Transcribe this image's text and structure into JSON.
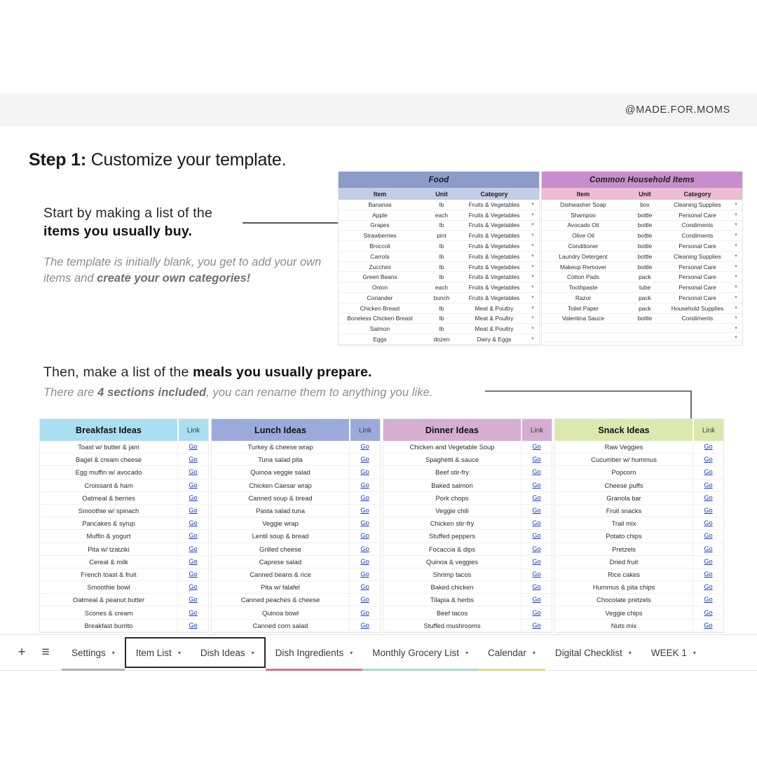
{
  "banner": {
    "handle": "@MADE.FOR.MOMS"
  },
  "heading": {
    "bold": "Step 1:",
    "normal": "Customize your template."
  },
  "callout1": {
    "line1": "Start by making a list of the",
    "line2": "items you usually buy.",
    "sub_pre": "The template is initially blank, you get to add your own items and ",
    "sub_bold": "create your own categories!"
  },
  "callout2": {
    "l1_pre": "Then, make a list of the ",
    "l1_bold": "meals you usually prepare.",
    "l2_pre": "There are ",
    "l2_bold": "4 sections included",
    "l2_post": ", you can rename them to anything you like."
  },
  "sheets": [
    {
      "title": "Food",
      "title_color": "#8b9cc9",
      "subhead_color": "#c2cde6",
      "columns": [
        "Item",
        "Unit",
        "Category"
      ],
      "rows": [
        [
          "Bananas",
          "lb",
          "Fruits & Vegetables"
        ],
        [
          "Apple",
          "each",
          "Fruits & Vegetables"
        ],
        [
          "Grapes",
          "lb",
          "Fruits & Vegetables"
        ],
        [
          "Strawberries",
          "pint",
          "Fruits & Vegetables"
        ],
        [
          "Broccoli",
          "lb",
          "Fruits & Vegetables"
        ],
        [
          "Carrots",
          "lb",
          "Fruits & Vegetables"
        ],
        [
          "Zucchini",
          "lb",
          "Fruits & Vegetables"
        ],
        [
          "Green Beans",
          "lb",
          "Fruits & Vegetables"
        ],
        [
          "Onion",
          "each",
          "Fruits & Vegetables"
        ],
        [
          "Coriander",
          "bunch",
          "Fruits & Vegetables"
        ],
        [
          "Chicken Breast",
          "lb",
          "Meat & Poultry"
        ],
        [
          "Boneless Chicken Breast",
          "lb",
          "Meat & Poultry"
        ],
        [
          "Salmon",
          "lb",
          "Meat & Poultry"
        ],
        [
          "Eggs",
          "dozen",
          "Dairy & Eggs"
        ]
      ],
      "blank_rows": 0
    },
    {
      "title": "Common Household Items",
      "title_color": "#c78ecd",
      "subhead_color": "#edbcd5",
      "columns": [
        "Item",
        "Unit",
        "Category"
      ],
      "rows": [
        [
          "Dishwasher Soap",
          "box",
          "Cleaning Supplies"
        ],
        [
          "Shampoo",
          "bottle",
          "Personal Care"
        ],
        [
          "Avocado Oil",
          "bottle",
          "Condiments"
        ],
        [
          "Olive Oil",
          "bottle",
          "Condiments"
        ],
        [
          "Conditioner",
          "bottle",
          "Personal Care"
        ],
        [
          "Laundry Detergent",
          "bottle",
          "Cleaning Supplies"
        ],
        [
          "Makeup Remover",
          "bottle",
          "Personal Care"
        ],
        [
          "Cotton Pads",
          "pack",
          "Personal Care"
        ],
        [
          "Toothpaste",
          "tube",
          "Personal Care"
        ],
        [
          "Razor",
          "pack",
          "Personal Care"
        ],
        [
          "Toilet Paper",
          "pack",
          "Household Supplies"
        ],
        [
          "Valentina Sauce",
          "bottle",
          "Condiments"
        ]
      ],
      "blank_rows": 2
    }
  ],
  "meals": [
    {
      "title": "Breakfast Ideas",
      "link_header": "Link",
      "header_color": "#a9dff1",
      "link_label": "Go",
      "items": [
        "Toast w/ butter & jam",
        "Bagel & cream cheese",
        "Egg muffin w/ avocado",
        "Croissant & ham",
        "Oatmeal & berries",
        "Smoothie w/ spinach",
        "Pancakes & syrup",
        "Muffin & yogurt",
        "Pita w/ tzatziki",
        "Cereal & milk",
        "French toast & fruit",
        "Smoothie bowl",
        "Oatmeal & peanut butter",
        "Scones & cream",
        "Breakfast burrito"
      ]
    },
    {
      "title": "Lunch Ideas",
      "link_header": "Link",
      "header_color": "#9aabdb",
      "link_label": "Go",
      "items": [
        "Turkey & cheese wrap",
        "Tuna salad pita",
        "Quinoa veggie salad",
        "Chicken Caesar wrap",
        "Canned soup & bread",
        "Pasta salad tuna",
        "Veggie wrap",
        "Lentil soup & bread",
        "Grilled cheese",
        "Caprese salad",
        "Canned beans & rice",
        "Pita w/ falafel",
        "Canned peaches & cheese",
        "Quinoa bowl",
        "Canned corn salad"
      ]
    },
    {
      "title": "Dinner Ideas",
      "link_header": "Link",
      "header_color": "#d5aed2",
      "link_label": "Go",
      "items": [
        "Chicken and Vegetable Soup",
        "Spaghetti & sauce",
        "Beef stir-fry",
        "Baked salmon",
        "Pork chops",
        "Veggie chili",
        "Chicken stir-fry",
        "Stuffed peppers",
        "Focaccia & dips",
        "Quinoa & veggies",
        "Shrimp tacos",
        "Baked chicken",
        "Tilapia & herbs",
        "Beef tacos",
        "Stuffed mushrooms"
      ]
    },
    {
      "title": "Snack Ideas",
      "link_header": "Link",
      "header_color": "#dbe8ae",
      "link_label": "Go",
      "items": [
        "Raw Veggies",
        "Cucumber w/ hummus",
        "Popcorn",
        "Cheese puffs",
        "Granola bar",
        "Fruit snacks",
        "Trail mix",
        "Potato chips",
        "Pretzels",
        "Dried fruit",
        "Rice cakes",
        "Hummus & pita chips",
        "Chocolate pretzels",
        "Veggie chips",
        "Nuts mix"
      ]
    }
  ],
  "tabbar": {
    "add_icon": "+",
    "menu_icon": "≡",
    "caret": "▾",
    "tabs": [
      {
        "label": "Settings",
        "underline": "#b0b0b0",
        "boxed": false
      },
      {
        "label": "Item List",
        "underline": "",
        "boxed": true
      },
      {
        "label": "Dish Ideas",
        "underline": "",
        "boxed": true
      },
      {
        "label": "Dish Ingredients",
        "underline": "#d9729a",
        "boxed": false
      },
      {
        "label": "Monthly Grocery List",
        "underline": "#a8ddcf",
        "boxed": false
      },
      {
        "label": "Calendar",
        "underline": "#e0e080",
        "boxed": false
      },
      {
        "label": "Digital Checklist",
        "underline": "",
        "boxed": false
      },
      {
        "label": "WEEK 1",
        "underline": "",
        "boxed": false
      }
    ]
  }
}
